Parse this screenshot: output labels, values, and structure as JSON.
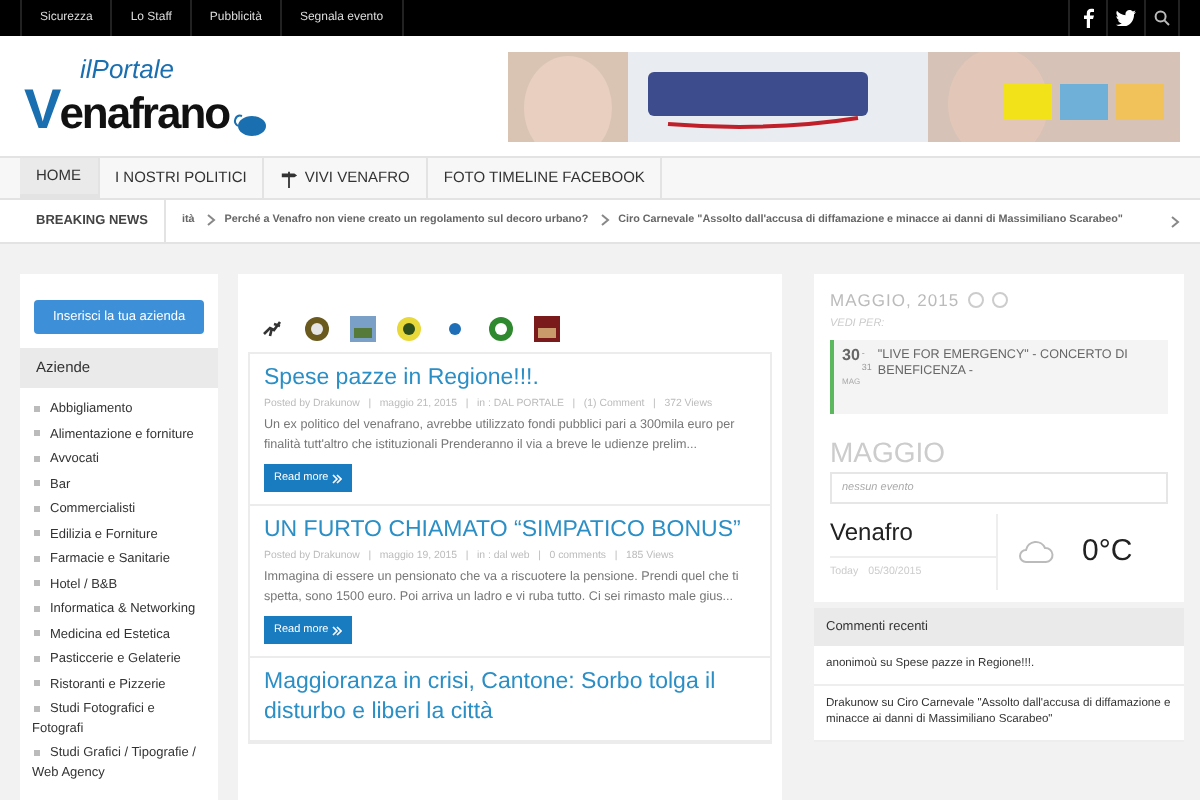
{
  "top_bar": {
    "links": [
      "Sicurezza",
      "Lo Staff",
      "Pubblicità",
      "Segnala evento"
    ]
  },
  "header": {
    "logo": {
      "prefix": "ilPortale",
      "name": "Venafrano"
    }
  },
  "nav": {
    "items": [
      {
        "label": "HOME",
        "selected": true,
        "kind": "plain"
      },
      {
        "label": "I NOSTRI POLITICI",
        "selected": false,
        "kind": "plain"
      },
      {
        "label": "VIVI VENAFRO",
        "selected": false,
        "kind": "signpost"
      },
      {
        "label": "FOTO TIMELINE FACEBOOK",
        "selected": false,
        "kind": "plain"
      }
    ]
  },
  "breaking_news": {
    "label": "BREAKING NEWS",
    "items": [
      "ità",
      "Perché a Venafro non viene creato un regolamento sul decoro urbano?",
      "Ciro Carnevale \"Assolto dall'accusa di diffamazione e minacce ai danni di Massimiliano Scarabeo\""
    ]
  },
  "sidebar": {
    "button": "Inserisci la tua azienda",
    "heading": "Aziende",
    "categories": [
      "Abbigliamento",
      "Alimentazione e forniture",
      "Avvocati",
      "Bar",
      "Commercialisti",
      "Edilizia e Forniture",
      "Farmacie e Sanitarie",
      "Hotel / B&B",
      "Informatica & Networking",
      "Medicina ed Estetica",
      "Pasticcerie e Gelaterie",
      "Ristoranti e Pizzerie",
      "Studi Fotografici e Fotografi",
      "Studi Grafici / Tipografie / Web Agency"
    ]
  },
  "posts": [
    {
      "title": "Spese pazze in Regione!!!.",
      "meta": "Posted by Drakunow   |   maggio 21, 2015   |   in : DAL PORTALE   |   (1) Comment   |   372 Views",
      "excerpt": "Un ex politico del venafrano, avrebbe utilizzato fondi pubblici pari a 300mila euro per finalità tutt'altro che istituzionali Prenderanno il via a breve le udienze prelim...",
      "read_more": "Read more"
    },
    {
      "title": "UN FURTO CHIAMATO “SIMPATICO BONUS”",
      "meta": "Posted by Drakunow   |   maggio 19, 2015   |   in : dal web   |   0 comments   |   185 Views",
      "excerpt": "Immagina di essere un pensionato che va a riscuotere la pensione. Prendi quel che ti spetta, sono 1500 euro. Poi arriva un ladro e vi ruba tutto. Ci sei rimasto male gius...",
      "read_more": "Read more"
    },
    {
      "title": "Maggioranza in crisi, Cantone: Sorbo tolga il disturbo e liberi la città"
    }
  ],
  "calendar": {
    "month": "MAGGIO, 2015",
    "view_by": "VEDI PER:",
    "event": {
      "day": "30",
      "range": "- 31",
      "month": "MAG",
      "title": "\"LIVE FOR EMERGENCY\" - CONCERTO DI BENEFICENZA -"
    },
    "next_month": "MAGGIO",
    "empty": "nessun evento"
  },
  "weather": {
    "city": "Venafro",
    "today": "Today",
    "date": "05/30/2015",
    "temperature": "0°C"
  },
  "recent_comments": {
    "heading": "Commenti recenti",
    "items": [
      "anonimoù su Spese pazze in Regione!!!.",
      "Drakunow su Ciro Carnevale \"Assolto dall'accusa di diffamazione e minacce ai danni di Massimiliano Scarabeo\""
    ]
  }
}
